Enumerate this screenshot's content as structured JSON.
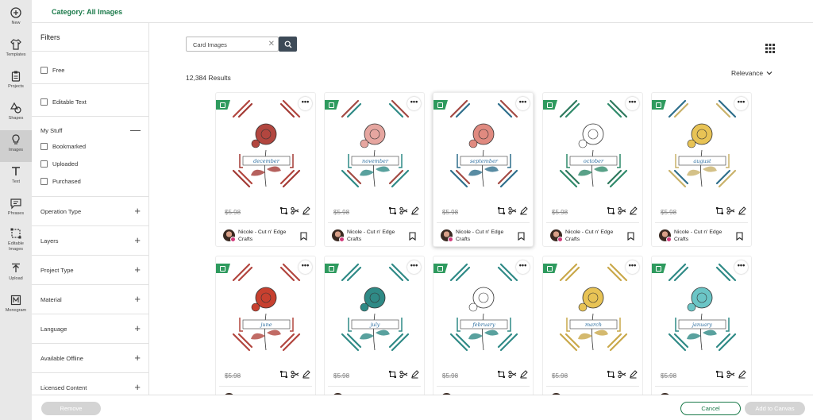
{
  "rail": [
    {
      "label": "New",
      "icon": "plus-circle-icon"
    },
    {
      "label": "Templates",
      "icon": "shirt-icon"
    },
    {
      "label": "Projects",
      "icon": "clipboard-icon"
    },
    {
      "label": "Shapes",
      "icon": "shapes-icon"
    },
    {
      "label": "Images",
      "icon": "lightbulb-icon"
    },
    {
      "label": "Text",
      "icon": "text-icon"
    },
    {
      "label": "Phrases",
      "icon": "speech-bubble-icon"
    },
    {
      "label": "Editable Images",
      "icon": "editable-images-icon"
    },
    {
      "label": "Upload",
      "icon": "upload-icon"
    },
    {
      "label": "Monogram",
      "icon": "monogram-icon"
    }
  ],
  "header": {
    "category": "Category: All Images"
  },
  "filters": {
    "title": "Filters",
    "free": "Free",
    "editable_text": "Editable Text",
    "my_stuff": "My Stuff",
    "bookmarked": "Bookmarked",
    "uploaded": "Uploaded",
    "purchased": "Purchased",
    "sections": [
      "Operation Type",
      "Layers",
      "Project Type",
      "Material",
      "Language",
      "Available Offline",
      "Licensed Content"
    ]
  },
  "search": {
    "value": "Card Images"
  },
  "results": "12,384 Results",
  "sort": "Relevance",
  "cards": [
    {
      "month": "december",
      "price": "$5.98",
      "author": "Nicole - Cut n' Edge Crafts",
      "accent": "#a33a35",
      "bar": "#b2463f",
      "flower": "#b2463f"
    },
    {
      "month": "november",
      "price": "$5.98",
      "author": "Nicole - Cut n' Edge Crafts",
      "accent": "#2f8a86",
      "bar": "#a34a44",
      "flower": "#e6a6a0"
    },
    {
      "month": "september",
      "price": "$5.98",
      "author": "Nicole - Cut n' Edge Crafts",
      "accent": "#2f6f8c",
      "bar": "#a34a44",
      "flower": "#e08a80"
    },
    {
      "month": "october",
      "price": "$5.98",
      "author": "Nicole - Cut n' Edge Crafts",
      "accent": "#2f8a6a",
      "bar": "#2f7a5e",
      "flower": "#ffffff"
    },
    {
      "month": "august",
      "price": "$5.98",
      "author": "Nicole - Cut n' Edge Crafts",
      "accent": "#c9b26a",
      "bar": "#2f6f8c",
      "flower": "#e8c355"
    },
    {
      "month": "june",
      "price": "$5.98",
      "author": "",
      "accent": "#b2463f",
      "bar": "#b2463f",
      "flower": "#c7402f"
    },
    {
      "month": "july",
      "price": "$5.98",
      "author": "",
      "accent": "#2f8a86",
      "bar": "#2f8a86",
      "flower": "#2f8a86"
    },
    {
      "month": "february",
      "price": "$5.98",
      "author": "",
      "accent": "#2f8a86",
      "bar": "#2f8a86",
      "flower": "#ffffff"
    },
    {
      "month": "march",
      "price": "$5.98",
      "author": "",
      "accent": "#c9a84a",
      "bar": "#c9a84a",
      "flower": "#e8c355"
    },
    {
      "month": "january",
      "price": "$5.98",
      "author": "",
      "accent": "#2f8a86",
      "bar": "#2f8a86",
      "flower": "#6bc5c6"
    }
  ],
  "footer": {
    "remove": "Remove",
    "cancel": "Cancel",
    "add": "Add to Canvas"
  }
}
